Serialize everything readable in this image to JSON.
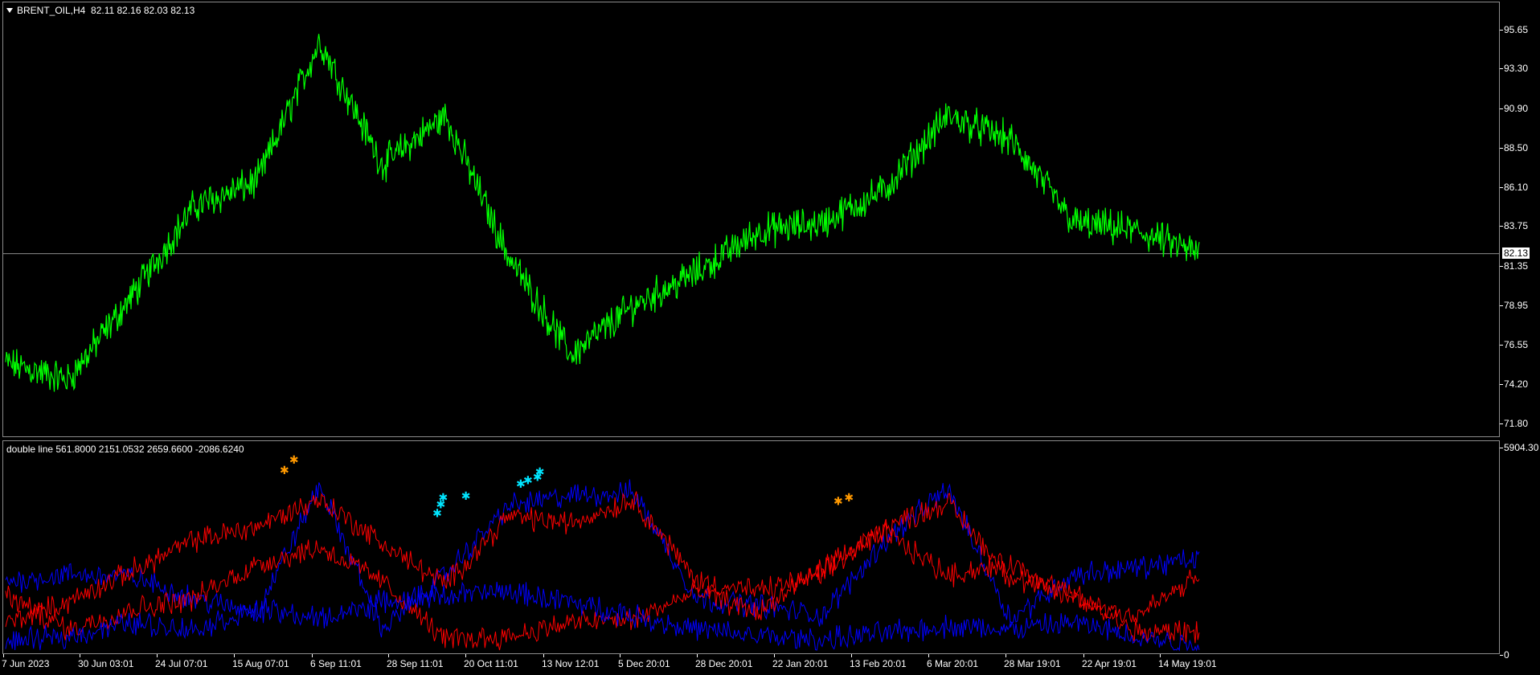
{
  "main_chart": {
    "symbol_label": "BRENT_OIL,H4",
    "ohlc_label": "82.11 82.16 82.03 82.13",
    "current_price": "82.13",
    "y_ticks": [
      "95.65",
      "93.30",
      "90.90",
      "88.50",
      "86.10",
      "83.75",
      "81.35",
      "78.95",
      "76.55",
      "74.20",
      "71.80"
    ],
    "colors": {
      "line": "#00ff00",
      "background": "#000000",
      "price_line": "#c0c0c0"
    }
  },
  "indicator": {
    "label": "double line 561.8000 2151.0532 2659.6600 -2086.6240",
    "y_ticks": [
      "5904.30",
      "0"
    ],
    "colors": {
      "blue": "#0000ff",
      "red": "#ff0000",
      "marker_orange": "#ff9900",
      "marker_cyan": "#00e5ff"
    }
  },
  "x_axis": {
    "labels": [
      "7 Jun 2023",
      "30 Jun 03:01",
      "24 Jul 07:01",
      "15 Aug 07:01",
      "6 Sep 11:01",
      "28 Sep 11:01",
      "20 Oct 11:01",
      "13 Nov 12:01",
      "5 Dec 20:01",
      "28 Dec 20:01",
      "22 Jan 20:01",
      "13 Feb 20:01",
      "6 Mar 20:01",
      "28 Mar 19:01",
      "22 Apr 19:01",
      "14 May 19:01"
    ]
  },
  "chart_data": [
    {
      "type": "line",
      "title": "BRENT_OIL,H4",
      "ylim": [
        71.8,
        95.65
      ],
      "x": [
        "7 Jun 2023",
        "30 Jun 03:01",
        "24 Jul 07:01",
        "15 Aug 07:01",
        "6 Sep 11:01",
        "28 Sep 11:01",
        "20 Oct 11:01",
        "13 Nov 12:01",
        "5 Dec 20:01",
        "28 Dec 20:01",
        "22 Jan 20:01",
        "13 Feb 20:01",
        "6 Mar 20:01",
        "28 Mar 19:01",
        "22 Apr 19:01",
        "14 May 19:01"
      ],
      "series": [
        {
          "values": [
            75.5,
            74.5,
            79.5,
            85.0,
            86.5,
            95.0,
            87.5,
            90.5,
            82.0,
            76.0,
            79.0,
            81.0,
            83.5,
            84.0,
            86.0,
            90.5,
            89.0,
            84.0,
            83.5,
            82.13
          ]
        }
      ]
    },
    {
      "type": "line",
      "title": "double line",
      "ylim": [
        0,
        5904.3
      ],
      "series": [
        {
          "values": [
            2000,
            2200,
            2150,
            1500,
            1100,
            4800,
            600,
            2200,
            4200,
            4500,
            4600,
            1500,
            1300,
            1000,
            3200,
            4700,
            900,
            2200,
            2400,
            2659.66
          ]
        },
        {
          "values": [
            800,
            1400,
            2300,
            3200,
            3600,
            4400,
            3100,
            1900,
            3900,
            3700,
            4400,
            2000,
            1700,
            2200,
            3600,
            4300,
            2100,
            1500,
            1000,
            2151.05
          ]
        },
        {
          "values": [
            1600,
            600,
            1200,
            1500,
            2500,
            3000,
            2000,
            300,
            400,
            800,
            900,
            1700,
            1100,
            2400,
            3400,
            2200,
            2500,
            1600,
            500,
            561.8
          ]
        },
        {
          "values": [
            200,
            400,
            800,
            600,
            1200,
            900,
            1400,
            1600,
            1700,
            1400,
            1000,
            600,
            400,
            300,
            500,
            700,
            600,
            800,
            400,
            100
          ]
        }
      ]
    }
  ]
}
